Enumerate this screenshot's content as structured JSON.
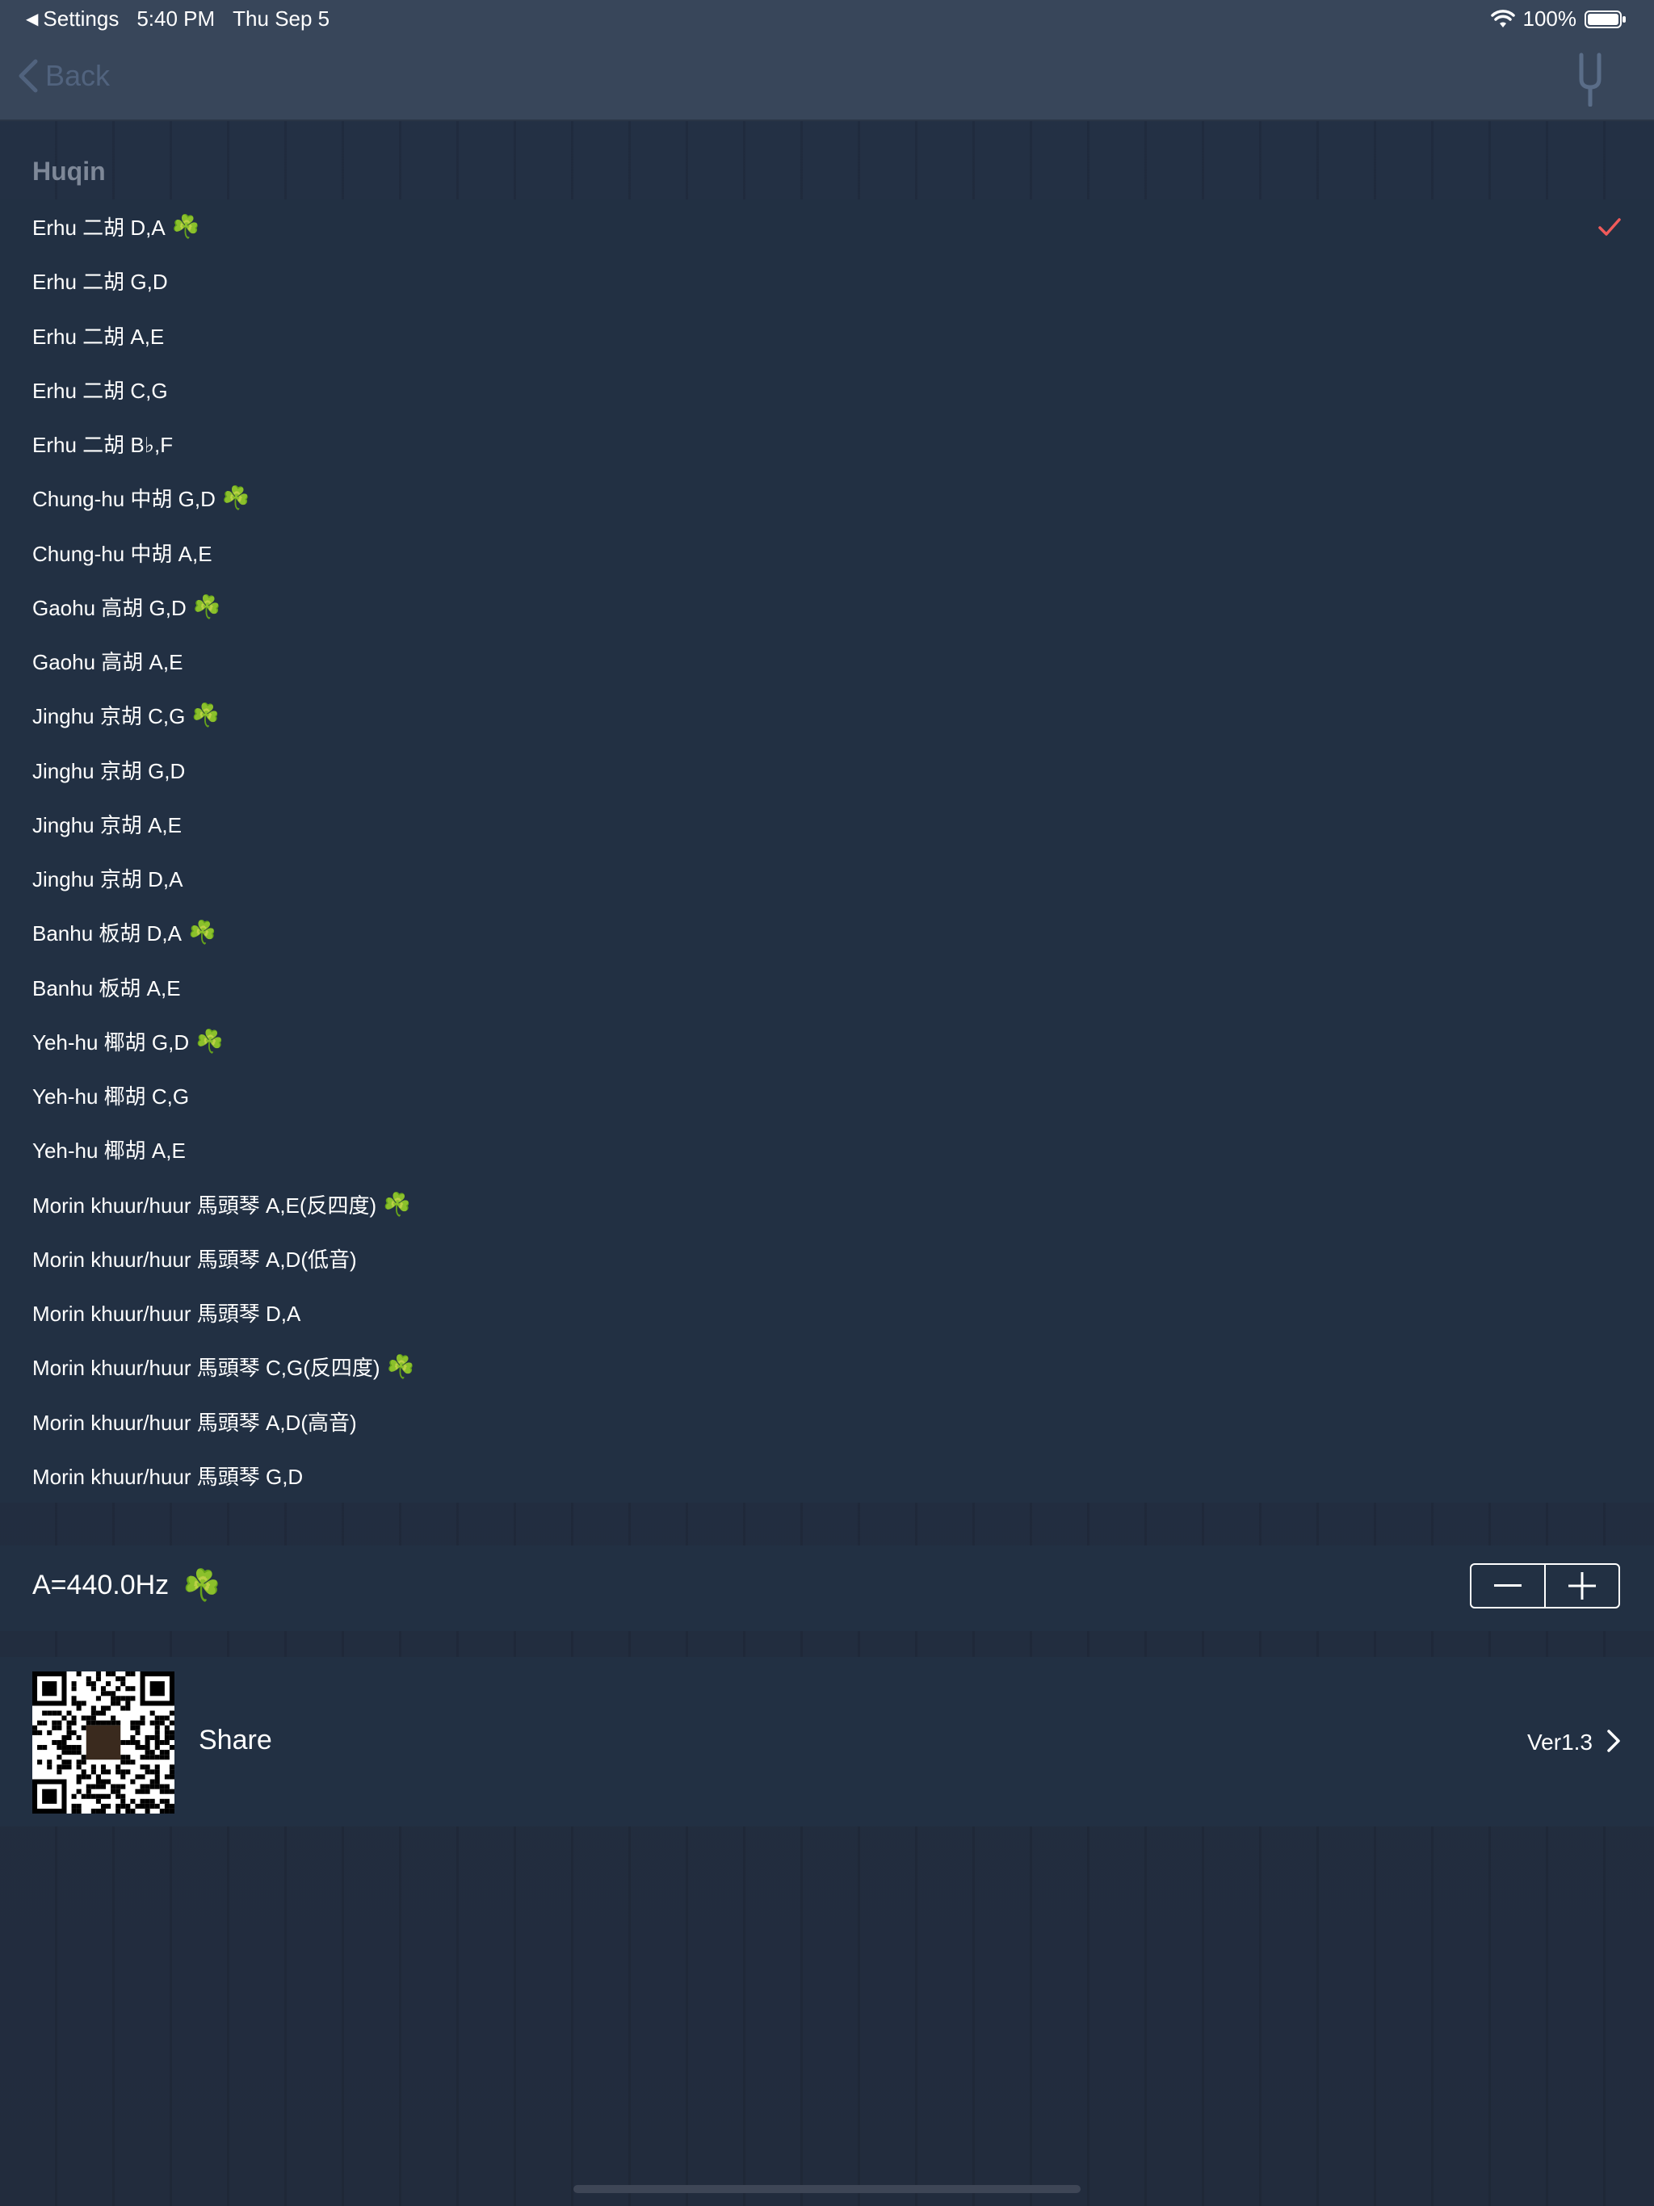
{
  "status_bar": {
    "back_app": "Settings",
    "time": "5:40 PM",
    "date": "Thu Sep 5",
    "battery": "100%"
  },
  "nav": {
    "back_label": "Back",
    "right_icon": "tuning-fork-icon"
  },
  "section": {
    "title": "Huqin"
  },
  "tunings": [
    {
      "label": "Erhu 二胡 D,A",
      "recommended": true,
      "selected": true
    },
    {
      "label": "Erhu 二胡 G,D",
      "recommended": false,
      "selected": false
    },
    {
      "label": "Erhu 二胡 A,E",
      "recommended": false,
      "selected": false
    },
    {
      "label": "Erhu 二胡 C,G",
      "recommended": false,
      "selected": false
    },
    {
      "label": "Erhu 二胡 B♭,F",
      "recommended": false,
      "selected": false
    },
    {
      "label": "Chung-hu 中胡 G,D",
      "recommended": true,
      "selected": false
    },
    {
      "label": "Chung-hu 中胡 A,E",
      "recommended": false,
      "selected": false
    },
    {
      "label": "Gaohu 高胡 G,D",
      "recommended": true,
      "selected": false
    },
    {
      "label": "Gaohu 高胡 A,E",
      "recommended": false,
      "selected": false
    },
    {
      "label": "Jinghu 京胡 C,G",
      "recommended": true,
      "selected": false
    },
    {
      "label": "Jinghu 京胡 G,D",
      "recommended": false,
      "selected": false
    },
    {
      "label": "Jinghu 京胡 A,E",
      "recommended": false,
      "selected": false
    },
    {
      "label": "Jinghu 京胡 D,A",
      "recommended": false,
      "selected": false
    },
    {
      "label": "Banhu 板胡 D,A",
      "recommended": true,
      "selected": false
    },
    {
      "label": "Banhu 板胡 A,E",
      "recommended": false,
      "selected": false
    },
    {
      "label": "Yeh-hu 椰胡 G,D",
      "recommended": true,
      "selected": false
    },
    {
      "label": "Yeh-hu 椰胡 C,G",
      "recommended": false,
      "selected": false
    },
    {
      "label": "Yeh-hu 椰胡 A,E",
      "recommended": false,
      "selected": false
    },
    {
      "label": "Morin khuur/huur 馬頭琴 A,E(反四度)",
      "recommended": true,
      "selected": false
    },
    {
      "label": "Morin khuur/huur 馬頭琴 A,D(低音)",
      "recommended": false,
      "selected": false
    },
    {
      "label": "Morin khuur/huur 馬頭琴 D,A",
      "recommended": false,
      "selected": false
    },
    {
      "label": "Morin khuur/huur 馬頭琴 C,G(反四度)",
      "recommended": true,
      "selected": false
    },
    {
      "label": "Morin khuur/huur 馬頭琴 A,D(高音)",
      "recommended": false,
      "selected": false
    },
    {
      "label": "Morin khuur/huur 馬頭琴 G,D",
      "recommended": false,
      "selected": false
    }
  ],
  "leaf_symbol": "☘️",
  "frequency": {
    "label": "A=440.0Hz",
    "decrement_icon": "minus-icon",
    "increment_icon": "plus-icon"
  },
  "share": {
    "label": "Share",
    "version": "Ver1.3",
    "qr_icon": "qr-code-icon"
  },
  "colors": {
    "background": "#222d3e",
    "bar": "#38465a",
    "back_tint": "#51637e",
    "checkmark": "#f05a5a",
    "leaf": "#3db34a"
  }
}
